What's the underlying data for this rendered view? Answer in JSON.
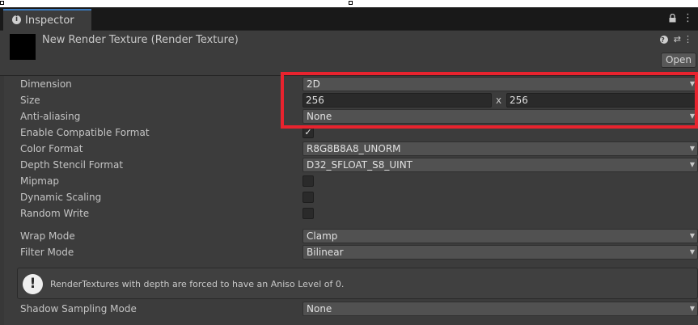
{
  "window": {
    "tab_title": "Inspector",
    "lock_icon": "lock-icon",
    "menu_icon": "menu-icon"
  },
  "header": {
    "asset_title": "New Render Texture (Render Texture)",
    "open_label": "Open"
  },
  "fields": {
    "dimension": {
      "label": "Dimension",
      "value": "2D"
    },
    "size": {
      "label": "Size",
      "width": "256",
      "separator": "x",
      "height": "256"
    },
    "anti_aliasing": {
      "label": "Anti-aliasing",
      "value": "None"
    },
    "enable_compatible_format": {
      "label": "Enable Compatible Format",
      "checked": true,
      "check_glyph": "✓"
    },
    "color_format": {
      "label": "Color Format",
      "value": "R8G8B8A8_UNORM"
    },
    "depth_stencil_format": {
      "label": "Depth Stencil Format",
      "value": "D32_SFLOAT_S8_UINT"
    },
    "mipmap": {
      "label": "Mipmap",
      "checked": false
    },
    "dynamic_scaling": {
      "label": "Dynamic Scaling",
      "checked": false
    },
    "random_write": {
      "label": "Random Write",
      "checked": false
    },
    "wrap_mode": {
      "label": "Wrap Mode",
      "value": "Clamp"
    },
    "filter_mode": {
      "label": "Filter Mode",
      "value": "Bilinear"
    },
    "shadow_sampling_mode": {
      "label": "Shadow Sampling Mode",
      "value": "None"
    }
  },
  "help": {
    "text": "RenderTextures with depth are forced to have an Aniso Level of 0.",
    "icon": "warning-icon"
  },
  "colors": {
    "highlight": "#e8232e",
    "tab_accent": "#3a79bb",
    "panel": "#3c3c3c"
  }
}
